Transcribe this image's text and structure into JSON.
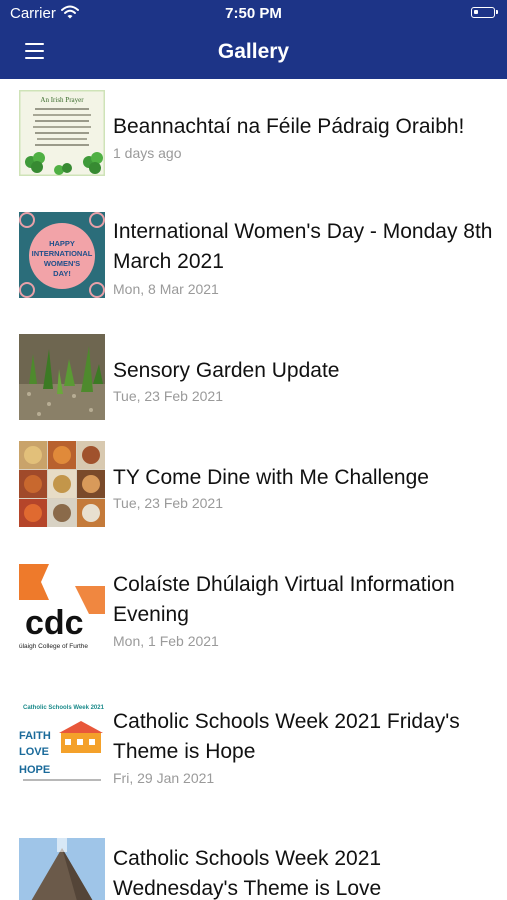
{
  "status_bar": {
    "carrier": "Carrier",
    "time": "7:50 PM"
  },
  "nav": {
    "title": "Gallery",
    "menu_icon": "hamburger-menu-icon"
  },
  "colors": {
    "header": "#1d3487",
    "title_text": "#111111",
    "date_text": "#9a9a9a"
  },
  "items": [
    {
      "title": "Beannachtaí na Féile Pádraig Oraibh!",
      "date": "1 days ago",
      "thumb_text": "An Irish Prayer"
    },
    {
      "title": "International Women's Day - Monday 8th March 2021",
      "date": "Mon, 8 Mar 2021",
      "thumb_text": "HAPPY INTERNATIONAL WOMEN'S DAY!"
    },
    {
      "title": "Sensory Garden Update",
      "date": "Tue, 23 Feb 2021",
      "thumb_text": ""
    },
    {
      "title": "TY Come Dine with Me Challenge",
      "date": "Tue, 23 Feb 2021",
      "thumb_text": ""
    },
    {
      "title": "Colaíste Dhúlaigh Virtual Information Evening",
      "date": "Mon, 1 Feb 2021",
      "thumb_text": "cdc",
      "thumb_subtext": "úlaigh College of Furthe"
    },
    {
      "title": "Catholic Schools Week 2021 Friday's Theme is Hope",
      "date": "Fri, 29 Jan 2021",
      "thumb_text": "Catholic Schools Week 2021",
      "thumb_words": [
        "FAITH",
        "LOVE",
        "HOPE"
      ]
    },
    {
      "title": "Catholic Schools Week 2021 Wednesday's Theme is Love",
      "date": "",
      "thumb_text": ""
    }
  ]
}
